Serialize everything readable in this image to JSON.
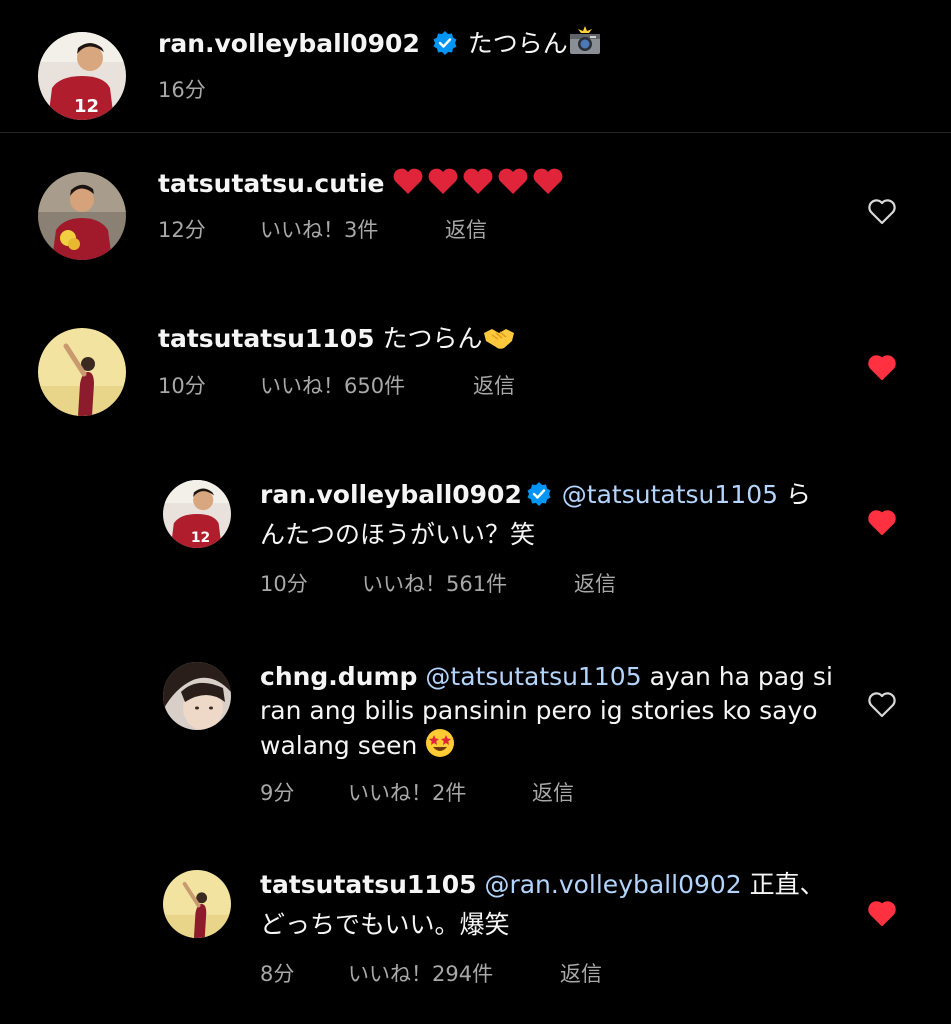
{
  "caption": {
    "username": "ran.volleyball0902",
    "text": "たつらん",
    "time": "16分"
  },
  "colors": {
    "background": "#000000",
    "text": "#f5f5f5",
    "secondary": "#a8a8a8",
    "mention": "#b3d4fc",
    "like_red": "#ff3040",
    "verified_blue": "#0095f6"
  },
  "comments": [
    {
      "username": "tatsutatsu.cutie",
      "text": "",
      "time": "12分",
      "likes_label": "いいね！3件",
      "reply_label": "返信",
      "liked": false
    },
    {
      "username": "tatsutatsu1105",
      "text": "たつらん",
      "time": "10分",
      "likes_label": "いいね！650件",
      "reply_label": "返信",
      "liked": true
    },
    {
      "username": "ran.volleyball0902",
      "mention": "@tatsutatsu1105",
      "text_line1": "ら",
      "text_line2": "んたつのほうがいい？笑",
      "time": "10分",
      "likes_label": "いいね！561件",
      "reply_label": "返信",
      "liked": true
    },
    {
      "username": "chng.dump",
      "mention": "@tatsutatsu1105",
      "text_line1": "ayan ha pag si",
      "text_line2": "ran ang bilis pansinin pero ig stories ko sayo",
      "text_line3": "walang seen",
      "time": "9分",
      "likes_label": "いいね！2件",
      "reply_label": "返信",
      "liked": false
    },
    {
      "username": "tatsutatsu1105",
      "mention": "@ran.volleyball0902",
      "text_line1": "正直、",
      "text_line2": "どっちでもいい。爆笑",
      "time": "8分",
      "likes_label": "いいね！294件",
      "reply_label": "返信",
      "liked": true
    }
  ]
}
